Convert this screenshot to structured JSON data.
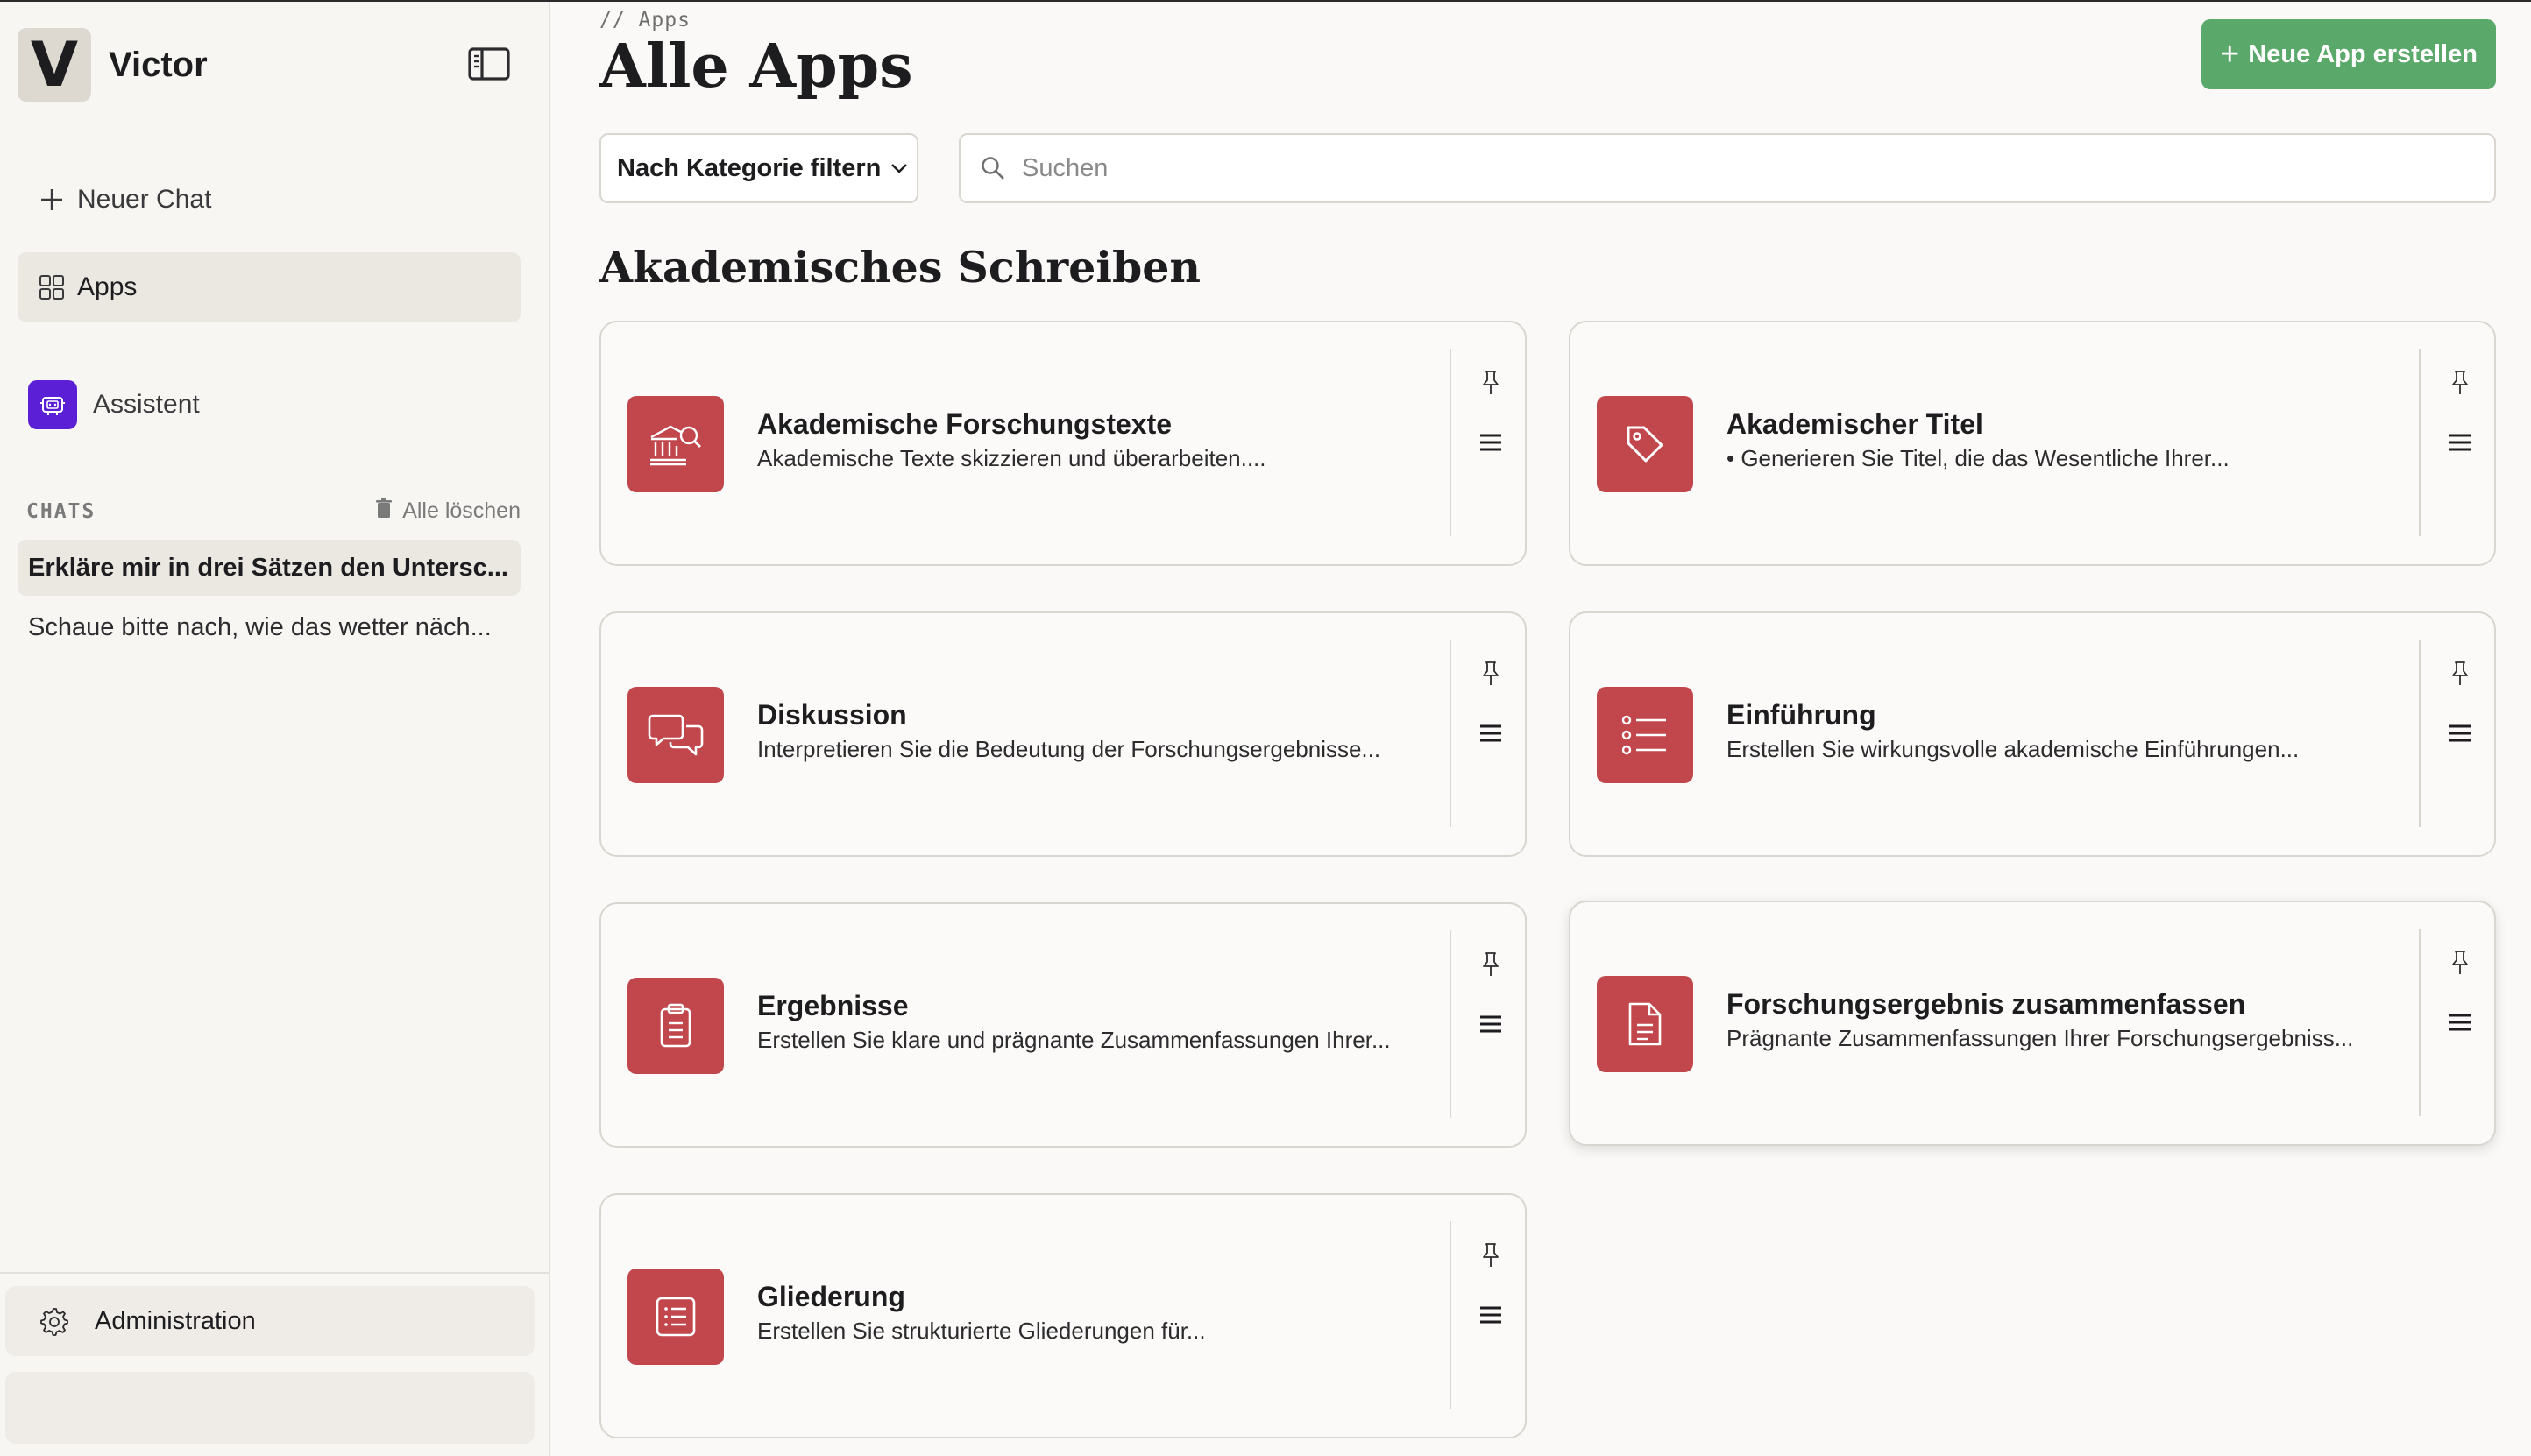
{
  "brand": {
    "logo_letter": "V",
    "name": "Victor"
  },
  "sidebar": {
    "new_chat": "Neuer Chat",
    "apps": "Apps",
    "assistant": "Assistent",
    "chats_label": "CHATS",
    "delete_all": "Alle löschen",
    "chats": [
      "Erkläre mir in drei Sätzen den Untersc...",
      "Schaue bitte nach, wie das wetter näch..."
    ],
    "admin": "Administration"
  },
  "main": {
    "breadcrumb": "// Apps",
    "title": "Alle Apps",
    "new_app_button": "Neue App erstellen",
    "filter_label": "Nach Kategorie filtern",
    "search_placeholder": "Suchen",
    "section_title": "Akademisches Schreiben",
    "cards": [
      {
        "title": "Akademische Forschungstexte",
        "desc": "Akademische Texte skizzieren und überarbeiten....",
        "icon": "academic-research-icon"
      },
      {
        "title": "Akademischer Titel",
        "desc": "• Generieren Sie Titel, die das Wesentliche Ihrer...",
        "icon": "tag-icon"
      },
      {
        "title": "Diskussion",
        "desc": "Interpretieren Sie die Bedeutung der Forschungsergebnisse...",
        "icon": "chat-bubbles-icon"
      },
      {
        "title": "Einführung",
        "desc": "Erstellen Sie wirkungsvolle akademische Einführungen...",
        "icon": "list-icon"
      },
      {
        "title": "Ergebnisse",
        "desc": "Erstellen Sie klare und prägnante Zusammenfassungen Ihrer...",
        "icon": "clipboard-icon"
      },
      {
        "title": "Forschungsergebnis zusammenfassen",
        "desc": "Prägnante Zusammenfassungen Ihrer Forschungsergebniss...",
        "icon": "document-icon"
      },
      {
        "title": "Gliederung",
        "desc": "Erstellen Sie strukturierte Gliederungen für...",
        "icon": "outline-icon"
      }
    ]
  },
  "colors": {
    "accent_green": "#5aa86a",
    "app_icon_red": "#c1474d",
    "assistant_purple": "#5b1fd6"
  }
}
